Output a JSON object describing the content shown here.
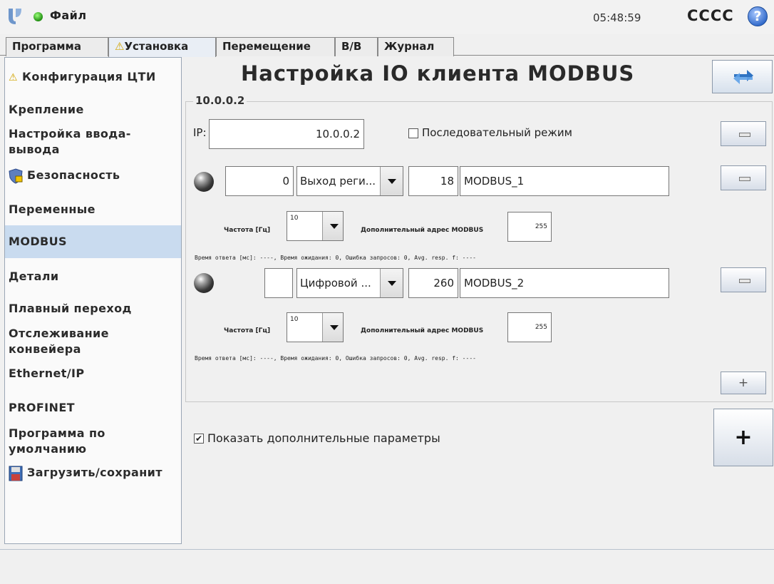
{
  "header": {
    "file_menu": "Файл",
    "time": "05:48:59",
    "robot_name": "CCCC",
    "help": "?"
  },
  "tabs": [
    {
      "label": "Программа"
    },
    {
      "label": "Установка",
      "warning": "⚠"
    },
    {
      "label": "Перемещение"
    },
    {
      "label": "В/В"
    },
    {
      "label": "Журнал"
    }
  ],
  "sidebar": {
    "items": [
      {
        "label": "Конфигурация ЦТИ",
        "icon": "warning-icon"
      },
      {
        "label": "Крепление"
      },
      {
        "label": "Настройка ввода-",
        "label2": "вывода"
      },
      {
        "label": "Безопасность",
        "icon": "safety-shield-icon"
      },
      {
        "label": "Переменные"
      },
      {
        "label": "MODBUS"
      },
      {
        "label": "Детали"
      },
      {
        "label": "Плавный переход"
      },
      {
        "label": "Отслеживание",
        "label2": "конвейера"
      },
      {
        "label": "Ethernet/IP"
      },
      {
        "label": "PROFINET"
      },
      {
        "label": "Программа по",
        "label2": "умолчанию"
      },
      {
        "label": "Загрузить/сохранит",
        "icon": "floppy-disk-icon"
      }
    ],
    "active": "MODBUS"
  },
  "main": {
    "title": "Настройка IO клиента MODBUS",
    "group_title": "10.0.0.2",
    "ip_label": "IP:",
    "ip_value": "10.0.0.2",
    "sequential_mode_label": "Последовательный режим",
    "sequential_mode_checked": false,
    "signals": [
      {
        "address": "0",
        "type": "Выход реги...",
        "register": "18",
        "name": "MODBUS_1",
        "frequency_label": "Частота [Гц]",
        "frequency": "10",
        "extra_address_label": "Дополнительный адрес MODBUS",
        "extra_address": "255",
        "stats": "Время ответа [мс]: ----, Время ожидания: 0, Ошибка запросов: 0, Avg. resp. f: ----"
      },
      {
        "address": "",
        "type": "Цифровой ...",
        "register": "260",
        "name": "MODBUS_2",
        "frequency_label": "Частота [Гц]",
        "frequency": "10",
        "extra_address_label": "Дополнительный адрес MODBUS",
        "extra_address": "255",
        "stats": "Время ответа [мс]: ----, Время ожидания: 0, Ошибка запросов: 0, Avg. resp. f: ----"
      }
    ],
    "show_advanced_label": "Показать дополнительные параметры",
    "show_advanced_checked": true,
    "add_signal": "+",
    "add_unit": "+"
  },
  "colors": {
    "active_sidebar": "#c9dbef",
    "status_ok": "#2da01b",
    "help": "#2f68c9"
  }
}
